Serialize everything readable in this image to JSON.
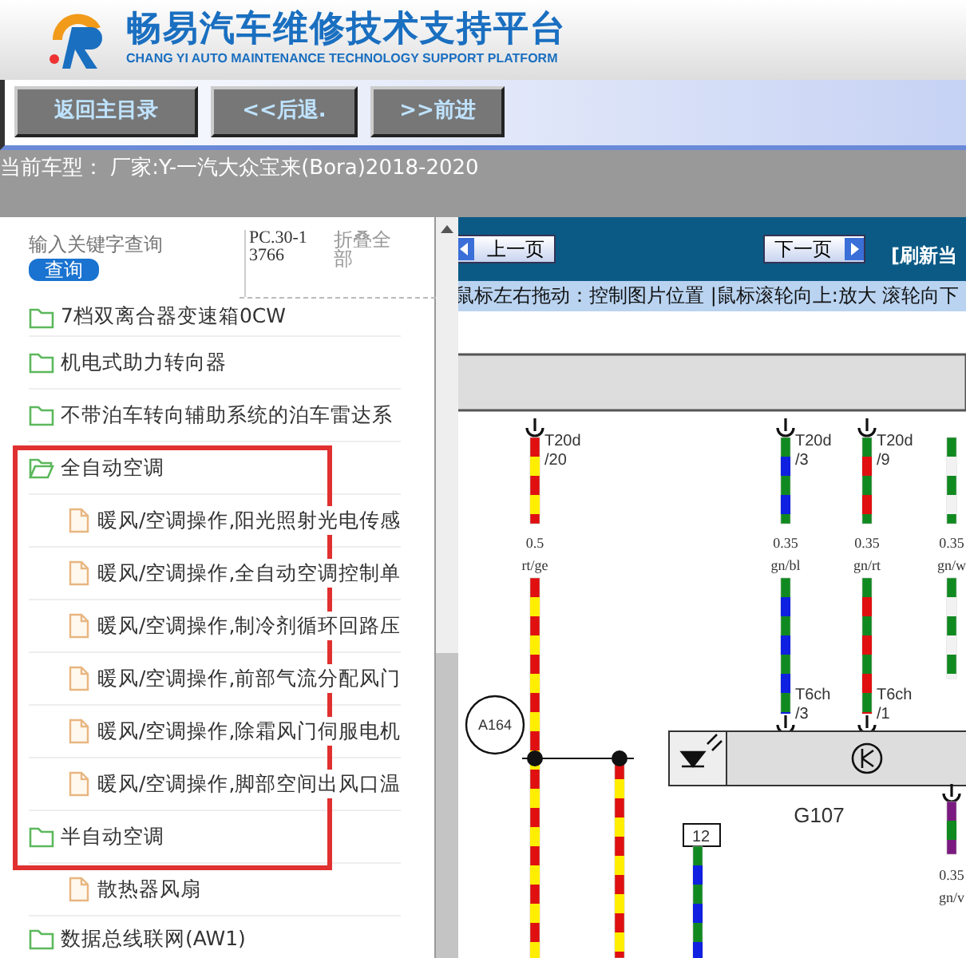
{
  "header": {
    "title": "畅易汽车维修技术支持平台",
    "subtitle": "CHANG YI AUTO MAINTENANCE TECHNOLOGY SUPPORT PLATFORM"
  },
  "toolbar": {
    "buttons": [
      "返回主目录",
      "<<后退.",
      ">>前进"
    ]
  },
  "current_model": "当前车型： 厂家:Y-一汽大众宝来(Bora)2018-2020",
  "sidebar": {
    "search": {
      "placeholder": "输入关键字查询",
      "button": "查询"
    },
    "code": "PC.30-13766",
    "collapse_all": "折叠全部",
    "tree": [
      {
        "kind": "folder",
        "label": "7档双离合器变速箱0CW",
        "open": false,
        "highlighted": false
      },
      {
        "kind": "folder",
        "label": "机电式助力转向器",
        "open": false,
        "highlighted": false
      },
      {
        "kind": "folder",
        "label": "不带泊车转向辅助系统的泊车雷达系",
        "open": false,
        "highlighted": false
      },
      {
        "kind": "folder",
        "label": "全自动空调",
        "open": true,
        "highlighted": true,
        "children": [
          {
            "kind": "file",
            "label": "暖风/空调操作,阳光照射光电传感"
          },
          {
            "kind": "file",
            "label": "暖风/空调操作,全自动空调控制单"
          },
          {
            "kind": "file",
            "label": "暖风/空调操作,制冷剂循环回路压"
          },
          {
            "kind": "file",
            "label": "暖风/空调操作,前部气流分配风门"
          },
          {
            "kind": "file",
            "label": "暖风/空调操作,除霜风门伺服电机"
          },
          {
            "kind": "file",
            "label": "暖风/空调操作,脚部空间出风口温"
          }
        ]
      },
      {
        "kind": "folder",
        "label": "半自动空调",
        "open": false,
        "highlighted": true,
        "children": [
          {
            "kind": "file",
            "label": "散热器风扇"
          }
        ]
      },
      {
        "kind": "folder",
        "label": "数据总线联网(AW1)",
        "open": false,
        "highlighted": false
      }
    ]
  },
  "viewer": {
    "prev": "上一页",
    "next": "下一页",
    "refresh": "[刷新当",
    "hint": "鼠标左右拖动：控制图片位置 |鼠标滚轮向上:放大  滚轮向下",
    "diagram": {
      "wires": [
        {
          "pin": "T20d",
          "pin_no": "/20",
          "gauge": "0.5",
          "code": "rt/ge",
          "segments": [
            {
              "color": "#e01010"
            },
            {
              "color": "#ffee00"
            }
          ]
        },
        {
          "pin": "T20d",
          "pin_no": "/3",
          "gauge": "0.35",
          "code": "gn/bl",
          "segments": [
            {
              "color": "#108a20"
            },
            {
              "color": "#1020e0"
            }
          ],
          "end_pin": "T6ch",
          "end_pin_no": "/3"
        },
        {
          "pin": "T20d",
          "pin_no": "/9",
          "gauge": "0.35",
          "code": "gn/rt",
          "segments": [
            {
              "color": "#108a20"
            },
            {
              "color": "#e01010"
            }
          ],
          "end_pin": "T6ch",
          "end_pin_no": "/1"
        },
        {
          "gauge": "0.35",
          "code": "gn/w",
          "segments": [
            {
              "color": "#108a20"
            },
            {
              "color": "#f2f2f2"
            }
          ]
        }
      ],
      "connector": "A164",
      "component": "G107",
      "terminal": "12",
      "lower_segments": [
        {
          "color": "#7a1a80"
        },
        {
          "color": "#108a20"
        }
      ],
      "lower_gauge": "0.35",
      "lower_code": "gn/v"
    }
  }
}
